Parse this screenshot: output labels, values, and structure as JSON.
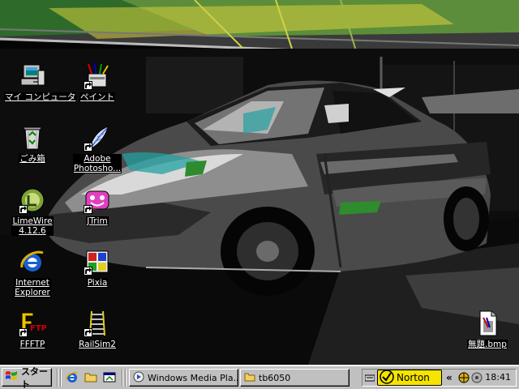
{
  "desktop": {
    "icons": [
      {
        "id": "mycomputer",
        "label": "マイ コンピュータ",
        "icon": "my-computer-icon"
      },
      {
        "id": "paint",
        "label": "ペイント",
        "icon": "paint-icon"
      },
      {
        "id": "recycle",
        "label": "ごみ箱",
        "icon": "recycle-bin-icon"
      },
      {
        "id": "photoshop",
        "label": "Adobe",
        "label2": "Photosho...",
        "icon": "photoshop-feather-icon"
      },
      {
        "id": "limewire",
        "label": "LimeWire",
        "label2": "4.12.6",
        "icon": "limewire-icon"
      },
      {
        "id": "jtrim",
        "label": "JTrim",
        "icon": "jtrim-icon"
      },
      {
        "id": "ie",
        "label": "Internet",
        "label2": "Explorer",
        "icon": "internet-explorer-icon"
      },
      {
        "id": "pixia",
        "label": "Pixia",
        "icon": "pixia-icon"
      },
      {
        "id": "ffftp",
        "label": "FFFTP",
        "icon": "ffftp-icon"
      },
      {
        "id": "railsim",
        "label": "RailSim2",
        "icon": "railsim-icon"
      },
      {
        "id": "bmp",
        "label": "無題.bmp",
        "icon": "bitmap-file-icon"
      }
    ]
  },
  "taskbar": {
    "start_label": "スタート",
    "quick_launch": [
      "internet-explorer-icon",
      "folder-icon",
      "show-desktop-icon"
    ],
    "tasks": [
      {
        "label": "Windows Media Pla...",
        "icon": "media-player-icon"
      },
      {
        "label": "tb6050",
        "icon": "folder-icon"
      }
    ],
    "tray": {
      "norton_label": "Norton",
      "chevron": "«",
      "clock": "18:41"
    }
  },
  "colors": {
    "taskbar": "#c0c0c0",
    "norton": "#f5e300",
    "label_bg": "#000000"
  }
}
